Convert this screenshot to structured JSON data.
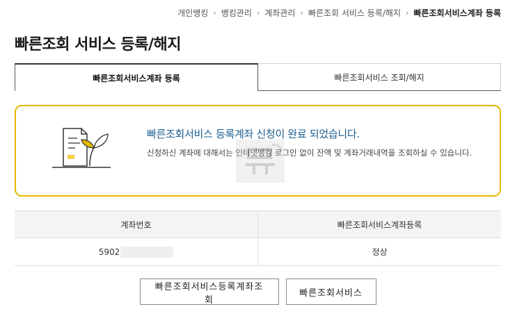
{
  "breadcrumb": {
    "items": [
      "개인뱅킹",
      "뱅킹관리",
      "계좌관리",
      "빠른조회 서비스 등록/해지",
      "빠른조회서비스계좌 등록"
    ]
  },
  "page": {
    "title": "빠른조회 서비스 등록/해지"
  },
  "tabs": [
    {
      "label": "빠른조회서비스계좌 등록",
      "active": true
    },
    {
      "label": "빠른조회서비스 조회/해지",
      "active": false
    }
  ],
  "notice": {
    "headline": "빠른조회서비스 등록계좌 신청이 완료 되었습니다.",
    "description": "신청하신 계좌에 대해서는 인터넷뱅킹 로그인 없이 잔액 및 계좌거래내역을 조회하실 수 있습니다.",
    "icon": "document-leaf-icon"
  },
  "table": {
    "headers": [
      "계좌번호",
      "빠른조회서비스계좌등록"
    ],
    "rows": [
      {
        "account": "5902",
        "status": "정상"
      }
    ]
  },
  "buttons": {
    "registered_accounts": "빠른조회서비스등록계좌조회",
    "quick_service": "빠른조회서비스"
  },
  "colors": {
    "accent_border": "#e8b800",
    "headline": "#1e5e8f",
    "leaf": "#e8b800"
  }
}
